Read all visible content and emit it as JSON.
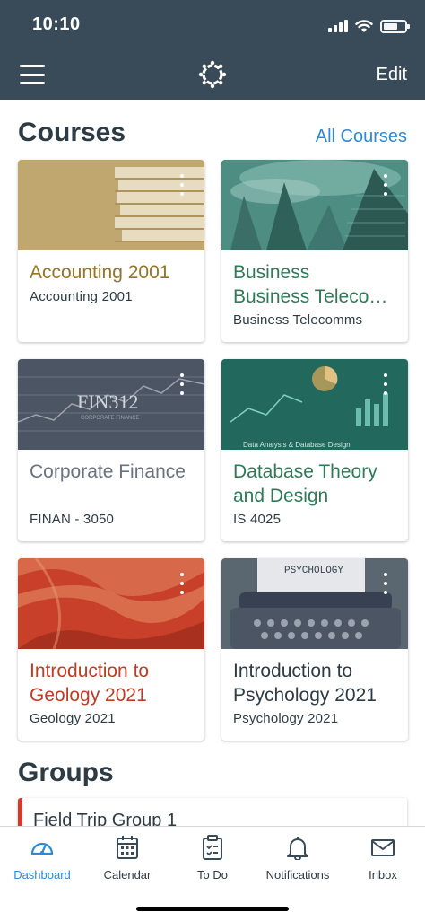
{
  "status_bar": {
    "time": "10:10"
  },
  "nav": {
    "edit_label": "Edit"
  },
  "courses": {
    "title": "Courses",
    "all_link": "All Courses",
    "items": [
      {
        "title": "Accounting 2001",
        "code": "Accounting 2001",
        "color": "#957424",
        "image": "books"
      },
      {
        "title": "Business Telecommunic...",
        "code": "Business Telecomms",
        "color": "#2f7b57",
        "image": "city-buildings"
      },
      {
        "title": "Corporate Finance",
        "code": "FINAN - 3050",
        "color": "#6b7280",
        "image": "stock-chart",
        "image_text": "FIN312",
        "image_subtext": "CORPORATE FINANCE"
      },
      {
        "title": "Database Theory and Design",
        "code": "IS 4025",
        "color": "#2f7b57",
        "image": "data-dashboard",
        "image_text": "Data Analysis & Database Design"
      },
      {
        "title": "Introduction to Geology 2021",
        "code": "Geology 2021",
        "color": "#c23b22",
        "image": "canyon"
      },
      {
        "title": "Introduction to Psychology 2021",
        "code": "Psychology 2021",
        "color": "#2d3b45",
        "image": "typewriter",
        "image_text": "PSYCHOLOGY"
      }
    ]
  },
  "groups": {
    "title": "Groups",
    "items": [
      {
        "name": "Field Trip Group 1",
        "color": "#d03b2a"
      }
    ]
  },
  "tabs": [
    {
      "label": "Dashboard",
      "icon": "dashboard-icon",
      "active": true,
      "color": "#2c8ad7"
    },
    {
      "label": "Calendar",
      "icon": "calendar-icon"
    },
    {
      "label": "To Do",
      "icon": "todo-icon"
    },
    {
      "label": "Notifications",
      "icon": "bell-icon"
    },
    {
      "label": "Inbox",
      "icon": "inbox-icon"
    }
  ],
  "colors": {
    "header": "#394b58",
    "link": "#2c8ad7"
  }
}
